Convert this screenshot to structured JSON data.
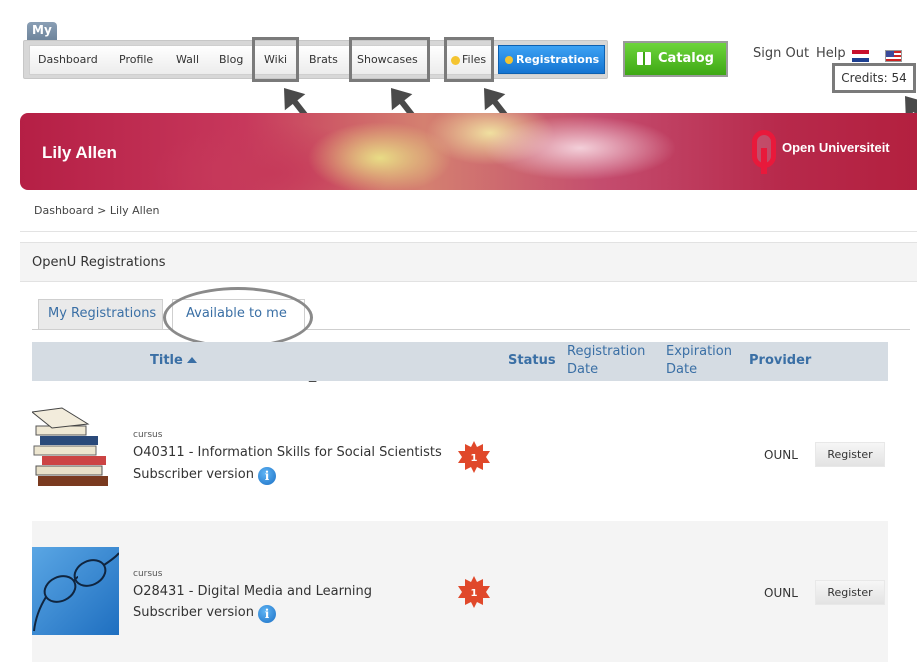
{
  "nav": {
    "my_tab": "My",
    "items": [
      "Dashboard",
      "Profile",
      "Wall",
      "Blog",
      "Wiki",
      "Brats",
      "Showcases",
      "Files"
    ],
    "registrations": "Registrations",
    "catalog": "Catalog",
    "sign_out": "Sign Out",
    "help": "Help",
    "credits": "Credits: 54"
  },
  "banner": {
    "user_name": "Lily Allen",
    "institution": "Open Universiteit"
  },
  "breadcrumb": "Dashboard >  Lily Allen",
  "panel": {
    "title": "OpenU Registrations"
  },
  "tabs": [
    "My Registrations",
    "Available to me"
  ],
  "table": {
    "columns": {
      "title": "Title",
      "status": "Status",
      "registration_date": [
        "Registration",
        "Date"
      ],
      "expiration_date": [
        "Expiration",
        "Date"
      ],
      "provider": "Provider"
    },
    "rows": [
      {
        "type": "cursus",
        "title": "O40311 - Information Skills for Social Scientists",
        "subscriber": "Subscriber version",
        "badge": "1",
        "provider": "OUNL",
        "action": "Register"
      },
      {
        "type": "cursus",
        "title": "O28431 - Digital Media and Learning",
        "subscriber": "Subscriber version",
        "badge": "1",
        "provider": "OUNL",
        "action": "Register"
      }
    ]
  },
  "colors": {
    "accent_blue": "#3a6fa5",
    "registrations_button": "#1e86e0",
    "catalog_button": "#4cb621",
    "banner": "#b51f45",
    "badge": "#e0482a"
  }
}
